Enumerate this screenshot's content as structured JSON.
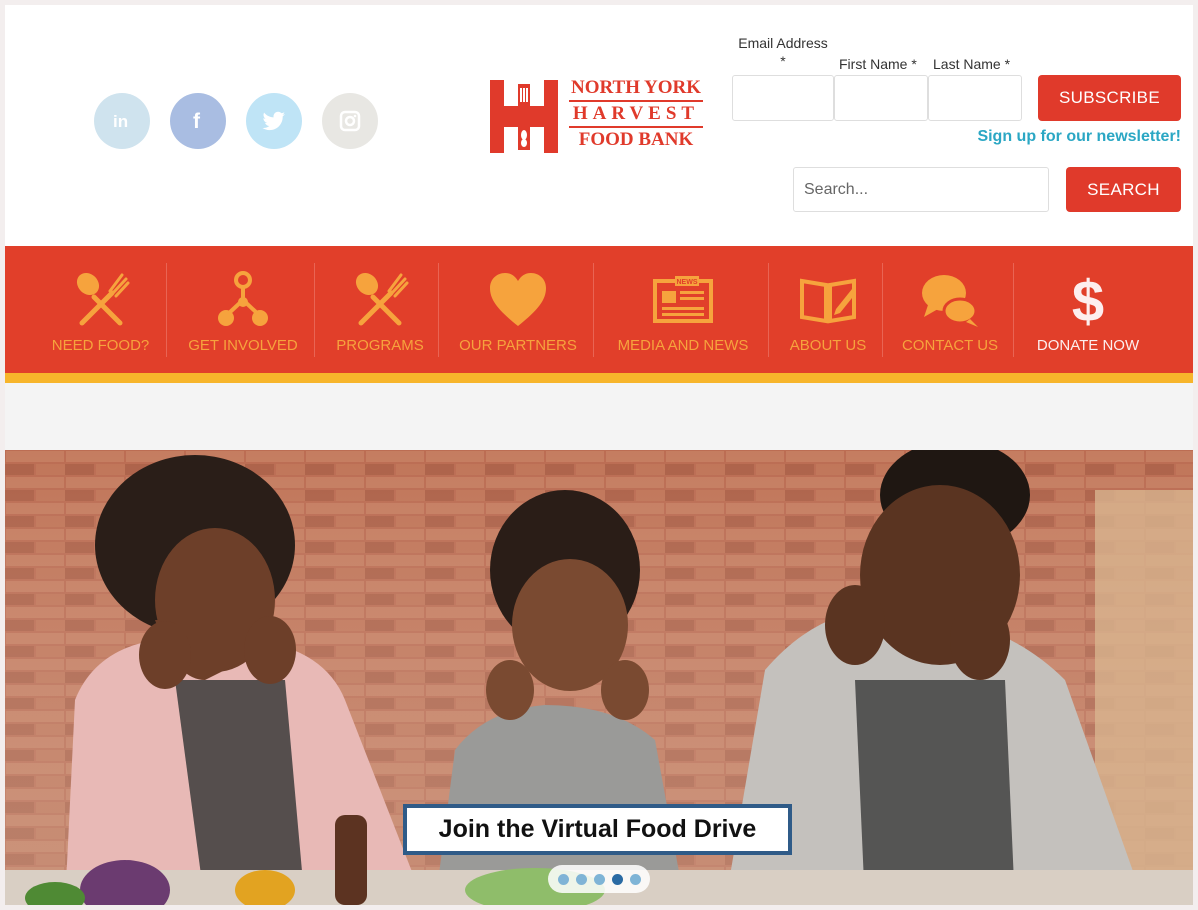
{
  "social": [
    "linkedin-icon",
    "facebook-icon",
    "twitter-icon",
    "instagram-icon"
  ],
  "logo": {
    "line1": "NORTH YORK",
    "line2": "HARVEST",
    "line3": "FOOD BANK"
  },
  "newsletter": {
    "email_label": "Email Address",
    "email_required": "*",
    "first_label": "First Name *",
    "last_label": "Last Name *",
    "subscribe_label": "SUBSCRIBE",
    "signup_text": "Sign up for our newsletter!"
  },
  "search": {
    "placeholder": "Search...",
    "button_label": "SEARCH"
  },
  "nav": {
    "items": [
      {
        "label": "NEED FOOD?",
        "icon": "fork-spoon-icon"
      },
      {
        "label": "GET INVOLVED",
        "icon": "network-icon"
      },
      {
        "label": "PROGRAMS",
        "icon": "fork-spoon-icon"
      },
      {
        "label": "OUR PARTNERS",
        "icon": "heart-icon"
      },
      {
        "label": "MEDIA AND NEWS",
        "icon": "newspaper-icon"
      },
      {
        "label": "ABOUT US",
        "icon": "open-book-icon"
      },
      {
        "label": "CONTACT US",
        "icon": "chat-bubbles-icon"
      },
      {
        "label": "DONATE NOW",
        "icon": "dollar-icon"
      }
    ],
    "news_badge": "NEWS"
  },
  "hero": {
    "caption": "Join the Virtual Food Drive",
    "slide_count": 5,
    "active_slide": 4
  },
  "colors": {
    "brand_red": "#e13f2a",
    "accent_yellow": "#f7b52b",
    "nav_label": "#f6a33d",
    "link_blue": "#2ba7c4",
    "caption_border": "#2f5b88"
  }
}
